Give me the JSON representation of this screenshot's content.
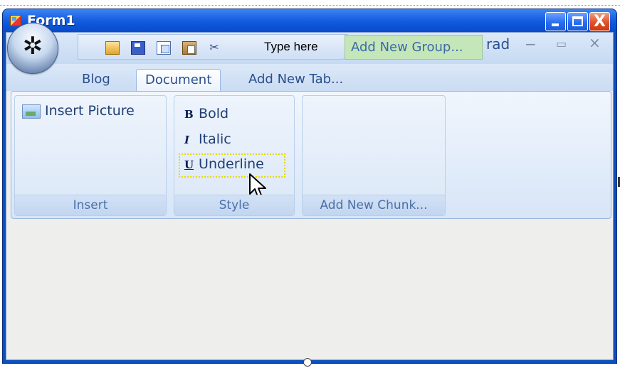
{
  "window": {
    "title": "Form1",
    "controls": [
      "minimize",
      "maximize",
      "close"
    ],
    "close_glyph": "X"
  },
  "office_button": {
    "icon": "office-logo-icon",
    "glyph": "✲"
  },
  "quick_access": {
    "icons": [
      "open-icon",
      "save-icon",
      "copy-icon",
      "paste-icon",
      "cut-icon"
    ],
    "cut_glyph": "✂",
    "type_here": "Type here",
    "add_group": "Add New Group..."
  },
  "ribbon_title": {
    "text": "rad",
    "min_glyph": "−",
    "max_glyph": "▭",
    "close_glyph": "×"
  },
  "tabs": [
    {
      "label": "Blog",
      "active": false
    },
    {
      "label": "Document",
      "active": true
    },
    {
      "label": "Add New Tab...",
      "active": false
    }
  ],
  "groups": {
    "insert": {
      "label": "Insert",
      "items": [
        {
          "label": "Insert Picture",
          "icon": "picture-icon"
        }
      ]
    },
    "style": {
      "label": "Style",
      "items": [
        {
          "label": "Bold",
          "icon": "bold-icon",
          "glyph": "B"
        },
        {
          "label": "Italic",
          "icon": "italic-icon",
          "glyph": "I"
        },
        {
          "label": "Underline",
          "icon": "underline-icon",
          "glyph": "U",
          "focused": true
        }
      ]
    },
    "new_chunk": {
      "label": "Add New Chunk..."
    }
  },
  "colors": {
    "titlebar": "#0c55d8",
    "ribbon_text": "#2a4f8c",
    "add_group_bg": "#c4e6b8",
    "focus_outline": "#e8d800"
  }
}
